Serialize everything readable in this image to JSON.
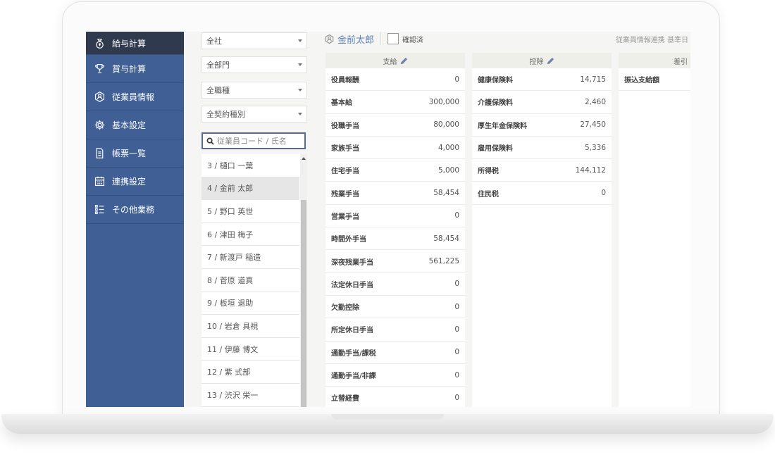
{
  "sidebar": {
    "items": [
      {
        "label": "給与計算",
        "icon": "money-bag-icon",
        "active": true
      },
      {
        "label": "賞与計算",
        "icon": "trophy-icon"
      },
      {
        "label": "従業員情報",
        "icon": "person-icon"
      },
      {
        "label": "基本設定",
        "icon": "gear-icon"
      },
      {
        "label": "帳票一覧",
        "icon": "document-icon"
      },
      {
        "label": "連携設定",
        "icon": "calendar-icon"
      },
      {
        "label": "その他業務",
        "icon": "list-icon"
      }
    ]
  },
  "filters": {
    "company": "全社",
    "department": "全部門",
    "job_type": "全職種",
    "contract_type": "全契約種別",
    "search_placeholder": "従業員コード / 氏名"
  },
  "employees": [
    "3 / 樋口 一葉",
    "4 / 金前 太郎",
    "5 / 野口 英世",
    "6 / 津田 梅子",
    "7 / 新渡戸 稲造",
    "8 / 菅原 道真",
    "9 / 板垣 退助",
    "10 / 岩倉 具視",
    "11 / 伊藤 博文",
    "12 / 紫 式部",
    "13 / 渋沢 栄一"
  ],
  "header": {
    "employee_name": "金前太郎",
    "confirmed_label": "確認済",
    "right_text": "従業員情報連携 基準日"
  },
  "payments": {
    "title": "支給",
    "rows": [
      {
        "label": "役員報酬",
        "value": "0"
      },
      {
        "label": "基本給",
        "value": "300,000"
      },
      {
        "label": "役職手当",
        "value": "80,000"
      },
      {
        "label": "家族手当",
        "value": "4,000"
      },
      {
        "label": "住宅手当",
        "value": "5,000"
      },
      {
        "label": "残業手当",
        "value": "58,454"
      },
      {
        "label": "営業手当",
        "value": "0"
      },
      {
        "label": "時間外手当",
        "value": "58,454"
      },
      {
        "label": "深夜残業手当",
        "value": "561,225"
      },
      {
        "label": "法定休日手当",
        "value": "0"
      },
      {
        "label": "欠勤控除",
        "value": "0"
      },
      {
        "label": "所定休日手当",
        "value": "0"
      },
      {
        "label": "通勤手当/課税",
        "value": "0"
      },
      {
        "label": "通勤手当/非課",
        "value": "0"
      },
      {
        "label": "立替経費",
        "value": "0"
      }
    ]
  },
  "deductions": {
    "title": "控除",
    "rows": [
      {
        "label": "健康保険料",
        "value": "14,715"
      },
      {
        "label": "介護保険料",
        "value": "2,460"
      },
      {
        "label": "厚生年金保険料",
        "value": "27,450"
      },
      {
        "label": "雇用保険料",
        "value": "5,336"
      },
      {
        "label": "所得税",
        "value": "144,112"
      },
      {
        "label": "住民税",
        "value": "0"
      }
    ]
  },
  "net": {
    "title": "差引",
    "rows": [
      {
        "label": "振込支給額",
        "value": ""
      }
    ]
  }
}
